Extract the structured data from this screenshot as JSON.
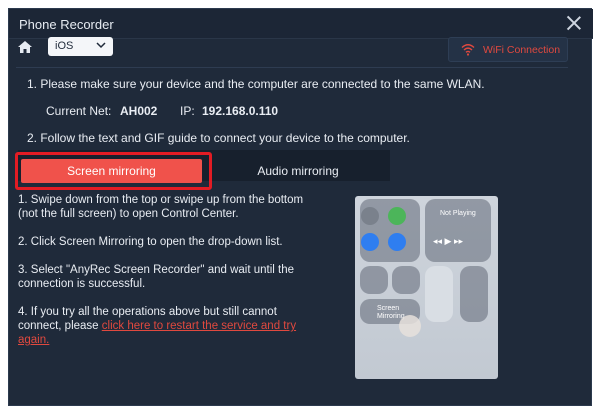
{
  "window": {
    "title": "Phone Recorder"
  },
  "toolbar": {
    "platform_select": "iOS",
    "wifi_button": "WiFi Connection"
  },
  "instructions": {
    "step1": "1. Please make sure your device and the computer are connected to the same WLAN.",
    "net_label": "Current Net:",
    "net_value": "AH002",
    "ip_label": "IP:",
    "ip_value": "192.168.0.110",
    "step2": "2. Follow the text and GIF guide to connect your device to the computer."
  },
  "tabs": [
    {
      "label": "Screen mirroring",
      "active": true
    },
    {
      "label": "Audio mirroring",
      "active": false
    }
  ],
  "guide": {
    "s1": "1. Swipe down from the top or swipe up from the bottom (not the full screen) to open Control Center.",
    "s2": "2. Click Screen Mirroring to open the drop-down list.",
    "s3": "3. Select \"AnyRec Screen Recorder\" and wait until the connection is successful.",
    "s4_prefix": "4. If you try all the operations above but still cannot connect, please ",
    "s4_link": "click here to restart the service and try again."
  },
  "phone_preview": {
    "now_playing": "Not Playing",
    "mirroring_label": "Screen\nMirroring"
  },
  "colors": {
    "accent": "#f0524b",
    "highlight_border": "#e21c24",
    "window_bg": "#1f2a3a"
  }
}
